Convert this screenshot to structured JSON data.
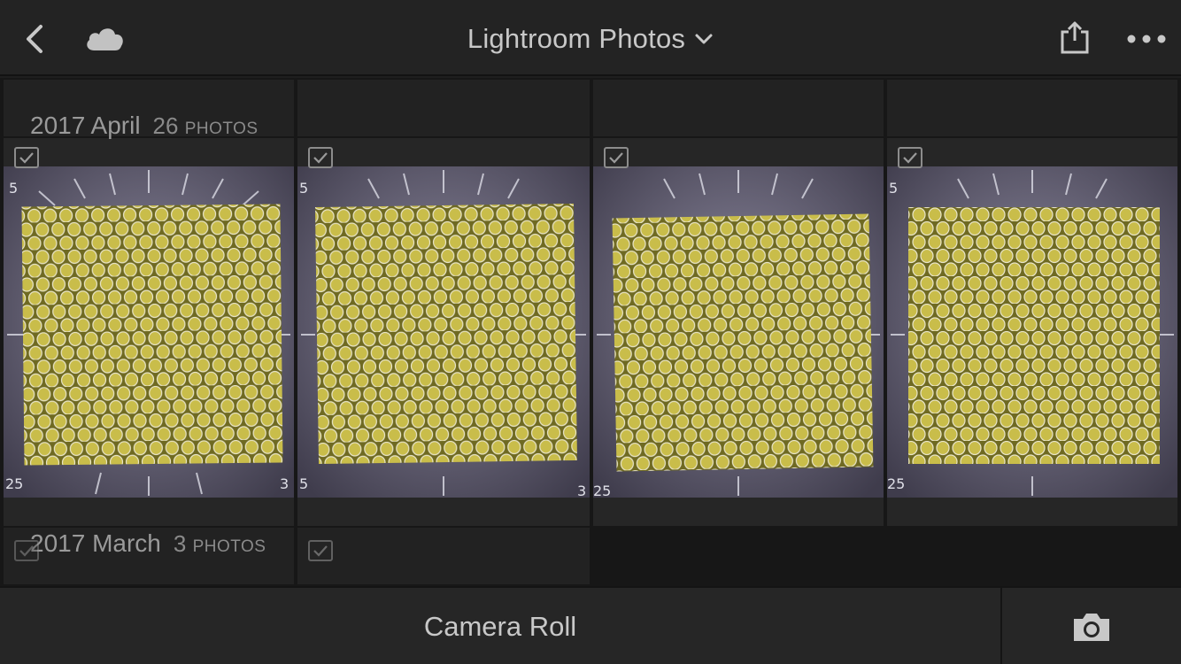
{
  "header": {
    "title": "Lightroom Photos",
    "back_icon": "chevron-left-icon",
    "cloud_icon": "cloud-icon",
    "share_icon": "share-icon",
    "more_icon": "more-icon",
    "dropdown_icon": "chevron-down-icon"
  },
  "sections": [
    {
      "title": "2017 April",
      "count": "26",
      "count_unit": "PHOTOS"
    },
    {
      "title": "2017 March",
      "count": "3",
      "count_unit": "PHOTOS"
    }
  ],
  "bottom": {
    "label": "Camera Roll",
    "camera_icon": "camera-icon"
  },
  "colors": {
    "background": "#1e1e1e",
    "bar": "#232323",
    "honeycomb": "#c9bd4a",
    "board": "#5a5866"
  }
}
